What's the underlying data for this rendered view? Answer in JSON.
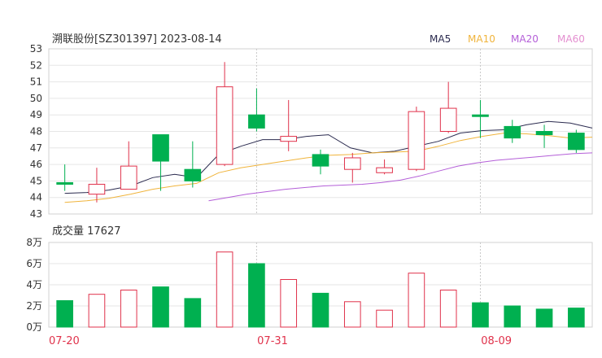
{
  "chart_data": {
    "type": "candlestick",
    "title": "溯联股份[SZ301397] 2023-08-14",
    "legend": [
      "MA5",
      "MA10",
      "MA20",
      "MA60"
    ],
    "colors": {
      "up": "#e0324b",
      "down": "#00b050",
      "MA5": "#2b2b4f",
      "MA10": "#f0b43c",
      "MA20": "#b45fd8",
      "MA60": "#e48fd0",
      "axis_date": "#e0324b",
      "grid": "#e6e6e6",
      "text": "#333333"
    },
    "price_axis": {
      "min": 43,
      "max": 53,
      "ticks": [
        "53",
        "52",
        "51",
        "50",
        "49",
        "48",
        "47",
        "46",
        "45",
        "44",
        "43"
      ]
    },
    "volume_label": "成交量 17627",
    "volume_axis": {
      "max": 8,
      "ticks": [
        "8万",
        "6万",
        "4万",
        "2万",
        "0万"
      ]
    },
    "date_labels": [
      "07-20",
      "07-31",
      "08-09"
    ],
    "candles": [
      {
        "o": 44.9,
        "c": 44.8,
        "h": 46.0,
        "l": 44.4
      },
      {
        "o": 44.2,
        "c": 44.8,
        "h": 45.8,
        "l": 43.7
      },
      {
        "o": 44.5,
        "c": 45.9,
        "h": 47.4,
        "l": 44.5
      },
      {
        "o": 47.8,
        "c": 46.2,
        "h": 47.8,
        "l": 44.4
      },
      {
        "o": 45.7,
        "c": 45.0,
        "h": 47.4,
        "l": 44.6
      },
      {
        "o": 46.0,
        "c": 50.7,
        "h": 52.2,
        "l": 45.9
      },
      {
        "o": 49.0,
        "c": 48.2,
        "h": 50.6,
        "l": 48.0
      },
      {
        "o": 47.4,
        "c": 47.7,
        "h": 49.9,
        "l": 46.8
      },
      {
        "o": 46.6,
        "c": 45.9,
        "h": 46.9,
        "l": 45.4
      },
      {
        "o": 45.7,
        "c": 46.4,
        "h": 46.7,
        "l": 44.9
      },
      {
        "o": 45.5,
        "c": 45.8,
        "h": 46.3,
        "l": 45.4
      },
      {
        "o": 45.7,
        "c": 49.2,
        "h": 49.5,
        "l": 45.6
      },
      {
        "o": 48.0,
        "c": 49.4,
        "h": 51.0,
        "l": 47.9
      },
      {
        "o": 49.0,
        "c": 48.9,
        "h": 49.9,
        "l": 47.6
      },
      {
        "o": 48.3,
        "c": 47.6,
        "h": 48.7,
        "l": 47.3
      },
      {
        "o": 48.0,
        "c": 47.8,
        "h": 48.4,
        "l": 47.0
      },
      {
        "o": 47.9,
        "c": 46.9,
        "h": 48.1,
        "l": 46.7
      }
    ],
    "volume": [
      2.5,
      3.1,
      3.5,
      3.8,
      2.7,
      7.1,
      6.0,
      4.5,
      3.2,
      2.4,
      1.6,
      5.1,
      3.5,
      2.3,
      2.0,
      1.7,
      1.8
    ],
    "series": [
      {
        "name": "MA5",
        "values": [
          44.25,
          44.3,
          44.45,
          44.7,
          45.2,
          45.4,
          45.2,
          46.6,
          47.1,
          47.5,
          47.5,
          47.7,
          47.8,
          47.0,
          46.7,
          46.8,
          47.1,
          47.4,
          47.9,
          48.05,
          48.1,
          48.4,
          48.6,
          48.5,
          48.2
        ]
      },
      {
        "name": "MA10",
        "values": [
          43.7,
          43.8,
          43.95,
          44.2,
          44.5,
          44.7,
          44.85,
          45.5,
          45.8,
          46.0,
          46.2,
          46.4,
          46.55,
          46.6,
          46.7,
          46.75,
          46.8,
          47.1,
          47.45,
          47.7,
          47.9,
          47.85,
          47.75,
          47.6,
          47.65
        ]
      },
      {
        "name": "MA20",
        "values": [
          43.8,
          44.0,
          44.2,
          44.35,
          44.5,
          44.6,
          44.7,
          44.75,
          44.8,
          44.9,
          45.05,
          45.3,
          45.6,
          45.9,
          46.1,
          46.25,
          46.35,
          46.45,
          46.55,
          46.65,
          46.7
        ]
      }
    ]
  }
}
